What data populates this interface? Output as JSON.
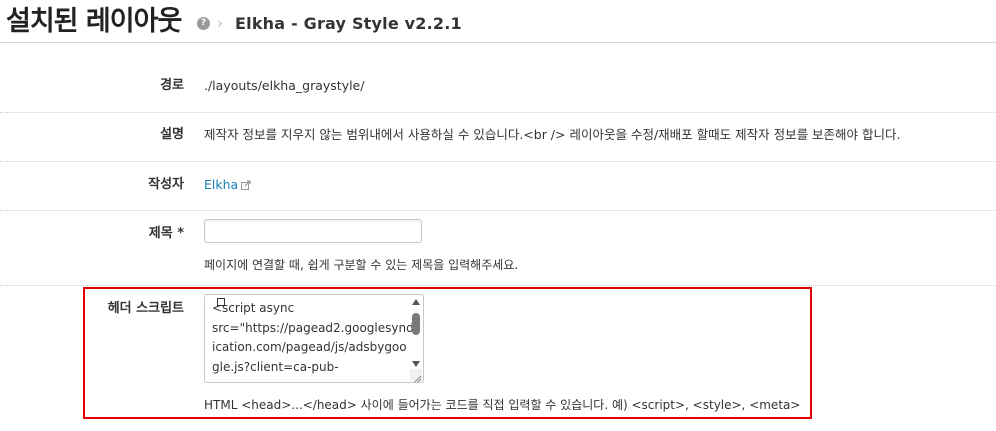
{
  "header": {
    "title": "설치된 레이아웃",
    "help_icon": "?",
    "separator": "›",
    "breadcrumb": "Elkha - Gray Style v2.2.1"
  },
  "rows": {
    "path": {
      "label": "경로",
      "value": "./layouts/elkha_graystyle/"
    },
    "description": {
      "label": "설명",
      "value": "제작자 정보를 지우지 않는 범위내에서 사용하실 수 있습니다.<br /> 레이아웃을 수정/재배포 할때도 제작자 정보를 보존해야 합니다."
    },
    "author": {
      "label": "작성자",
      "value": "Elkha",
      "icon": "external-link-icon"
    },
    "title": {
      "label": "제목 *",
      "value": "",
      "help": "페이지에 연결할 때, 쉽게 구분할 수 있는 제목을 입력해주세요."
    },
    "header_script": {
      "label": "헤더 스크립트",
      "value": "<script async\nsrc=\"https://pagead2.googlesynd\nication.com/pagead/js/adsbygoo\ngle.js?client=ca-pub-",
      "help": "HTML <head>...</head> 사이에 들어가는 코드를 직접 입력할 수 있습니다. 예) <script>, <style>, <meta>"
    }
  },
  "colors": {
    "highlight": "#e00000",
    "link": "#1a7fb5"
  }
}
